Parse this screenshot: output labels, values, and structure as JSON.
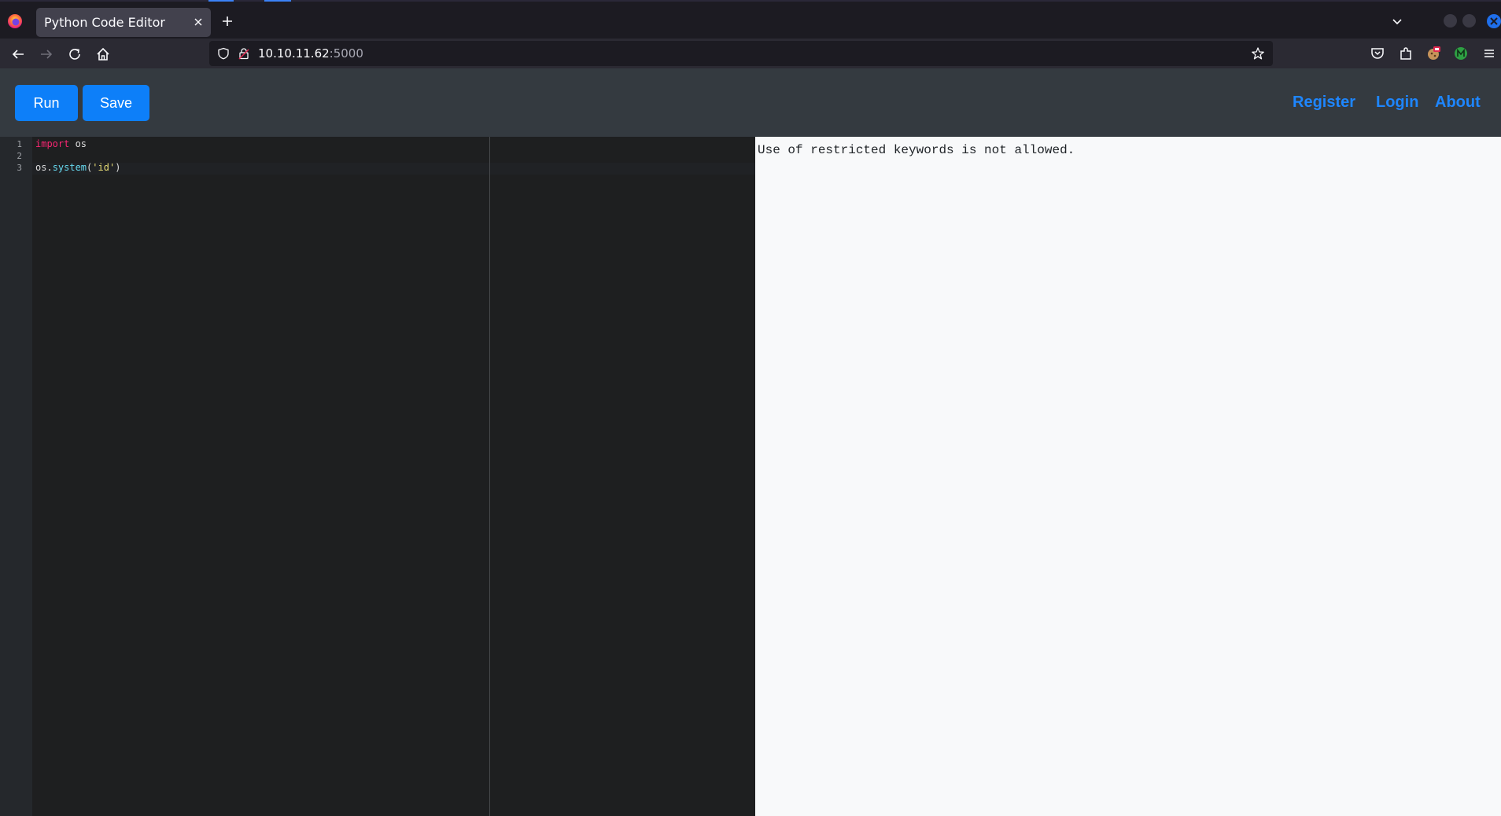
{
  "browser": {
    "tab_title": "Python Code Editor",
    "url_host": "10.10.11.62",
    "url_port": ":5000"
  },
  "app": {
    "buttons": {
      "run": "Run",
      "save": "Save"
    },
    "nav": {
      "register": "Register",
      "login": "Login",
      "about": "About"
    }
  },
  "editor": {
    "line_numbers": [
      "1",
      "2",
      "3"
    ],
    "lines": {
      "l1_keyword": "import",
      "l1_rest": " os",
      "l3_obj": "os.",
      "l3_fn": "system",
      "l3_open": "(",
      "l3_str": "'id'",
      "l3_close": ")"
    }
  },
  "output": {
    "text": "Use of restricted keywords is not allowed."
  },
  "colors": {
    "accent_button": "#0d7ff9",
    "nav_link": "#1e86ff",
    "header_bg": "#343a40",
    "editor_bg": "#1e1f20",
    "output_bg": "#f8f9fa"
  }
}
